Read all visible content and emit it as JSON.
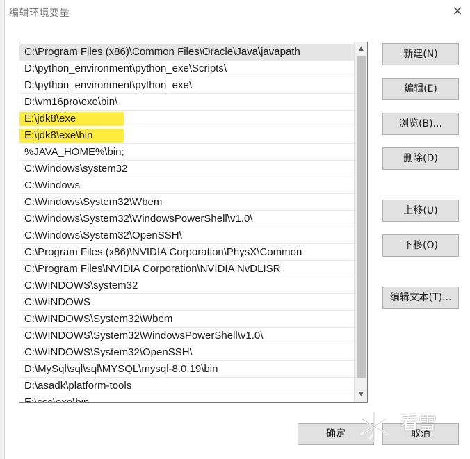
{
  "window": {
    "title": "编辑环境变量",
    "close_glyph": "✕"
  },
  "path_list": [
    {
      "text": "C:\\Program Files (x86)\\Common Files\\Oracle\\Java\\javapath",
      "selected": true
    },
    {
      "text": "D:\\python_environment\\python_exe\\Scripts\\"
    },
    {
      "text": "D:\\python_environment\\python_exe\\"
    },
    {
      "text": "D:\\vm16pro\\exe\\bin\\"
    },
    {
      "text": "E:\\jdk8\\exe",
      "highlighted": true
    },
    {
      "text": "E:\\jdk8\\exe\\bin",
      "highlighted": true
    },
    {
      "text": "%JAVA_HOME%\\bin;"
    },
    {
      "text": "C:\\Windows\\system32"
    },
    {
      "text": "C:\\Windows"
    },
    {
      "text": "C:\\Windows\\System32\\Wbem"
    },
    {
      "text": "C:\\Windows\\System32\\WindowsPowerShell\\v1.0\\"
    },
    {
      "text": "C:\\Windows\\System32\\OpenSSH\\"
    },
    {
      "text": "C:\\Program Files (x86)\\NVIDIA Corporation\\PhysX\\Common"
    },
    {
      "text": "C:\\Program Files\\NVIDIA Corporation\\NVIDIA NvDLISR"
    },
    {
      "text": "C:\\WINDOWS\\system32"
    },
    {
      "text": "C:\\WINDOWS"
    },
    {
      "text": "C:\\WINDOWS\\System32\\Wbem"
    },
    {
      "text": "C:\\WINDOWS\\System32\\WindowsPowerShell\\v1.0\\"
    },
    {
      "text": "C:\\WINDOWS\\System32\\OpenSSH\\"
    },
    {
      "text": "D:\\MySql\\sql\\sql\\MYSQL\\mysql-8.0.19\\bin"
    },
    {
      "text": "D:\\asadk\\platform-tools"
    },
    {
      "text": "E:\\ccc\\exe\\bin"
    }
  ],
  "buttons": {
    "new": "新建(N)",
    "edit": "编辑(E)",
    "browse": "浏览(B)...",
    "delete": "删除(D)",
    "move_up": "上移(U)",
    "move_down": "下移(O)",
    "edit_text": "编辑文本(T)...",
    "ok": "确定",
    "cancel": "取消"
  },
  "watermark": {
    "text": "看雪"
  },
  "colors": {
    "highlight": "#ffec3d",
    "selected_row": "#e5e5e5",
    "button_bg": "#e1e1e1",
    "button_border": "#adadad"
  }
}
